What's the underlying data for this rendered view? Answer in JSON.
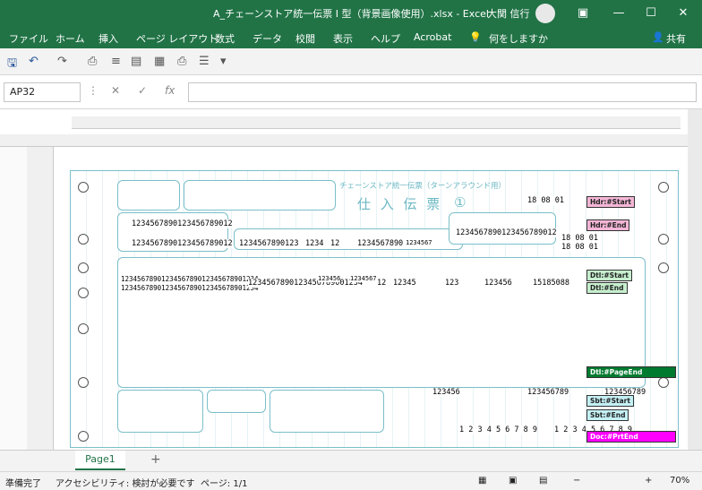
{
  "window": {
    "title": "A_チェーンストア統一伝票 I 型（背景画像使用）.xlsx  -  Excel",
    "user": "大関 信行",
    "restore_icon": "restore-icon",
    "min_label": "—",
    "max_label": "☐",
    "close_label": "✕"
  },
  "ribbon": {
    "tabs": [
      "ファイル",
      "ホーム",
      "挿入",
      "ページ レイアウト",
      "数式",
      "データ",
      "校閲",
      "表示",
      "ヘルプ",
      "Acrobat"
    ],
    "tell_me": "何をしますか",
    "share": "共有"
  },
  "formula_bar": {
    "name_box": "AP32",
    "fx_label": "fx",
    "value": ""
  },
  "sheet": {
    "form_title": "仕 入 伝 票",
    "form_number": "①",
    "header_caption": "チェーンストア統一伝票（ターンアラウンド用）",
    "cells": {
      "r1": "1234567890123456789012",
      "r2": "1234567890123456789012",
      "code1": "1234567890123",
      "num4": "1234",
      "num2": "12",
      "num7": "1234567890",
      "num6": "1234567",
      "addr": "1234567890123456789012",
      "item1": "1234567890123456789012345678901234",
      "item2": "1234567890123456789012345678901234",
      "item_code": "1234567890123456789001234",
      "q1": "123456",
      "q2": "1234567",
      "q3": "12",
      "q4": "12345",
      "q5": "123",
      "q6": "123456",
      "q7": "15185088",
      "t1": "123456",
      "t2": "123456789",
      "t3": "123456789",
      "digits": "1 2 3 4 5 6 7 8 9",
      "date1": "18 08 01",
      "date2": "18 08 01",
      "date3": "18 08 01"
    },
    "tags": {
      "hdr_start": "Hdr:#Start",
      "hdr_end": "Hdr:#End",
      "dtl_start": "Dtl:#Start",
      "dtl_end": "Dtl:#End",
      "dtl_page_end": "Dtl:#PageEnd",
      "sbt_start": "Sbt:#Start",
      "sbt_end": "Sbt:#End",
      "doc_prt_end": "Doc:#PrtEnd"
    }
  },
  "tabs": {
    "sheet1": "Page1",
    "add": "+"
  },
  "status": {
    "ready": "準備完了",
    "accessibility": "アクセシビリティ: 検討が必要です",
    "page": "ページ: 1/1",
    "zoom": "70%"
  },
  "colors": {
    "excel_green": "#217346",
    "tag_pink": "#f4b6d6",
    "tag_light_green": "#c6efce",
    "tag_dark_green": "#007a2f",
    "tag_cyan": "#c5f1f5",
    "tag_magenta": "#ff00ff"
  }
}
